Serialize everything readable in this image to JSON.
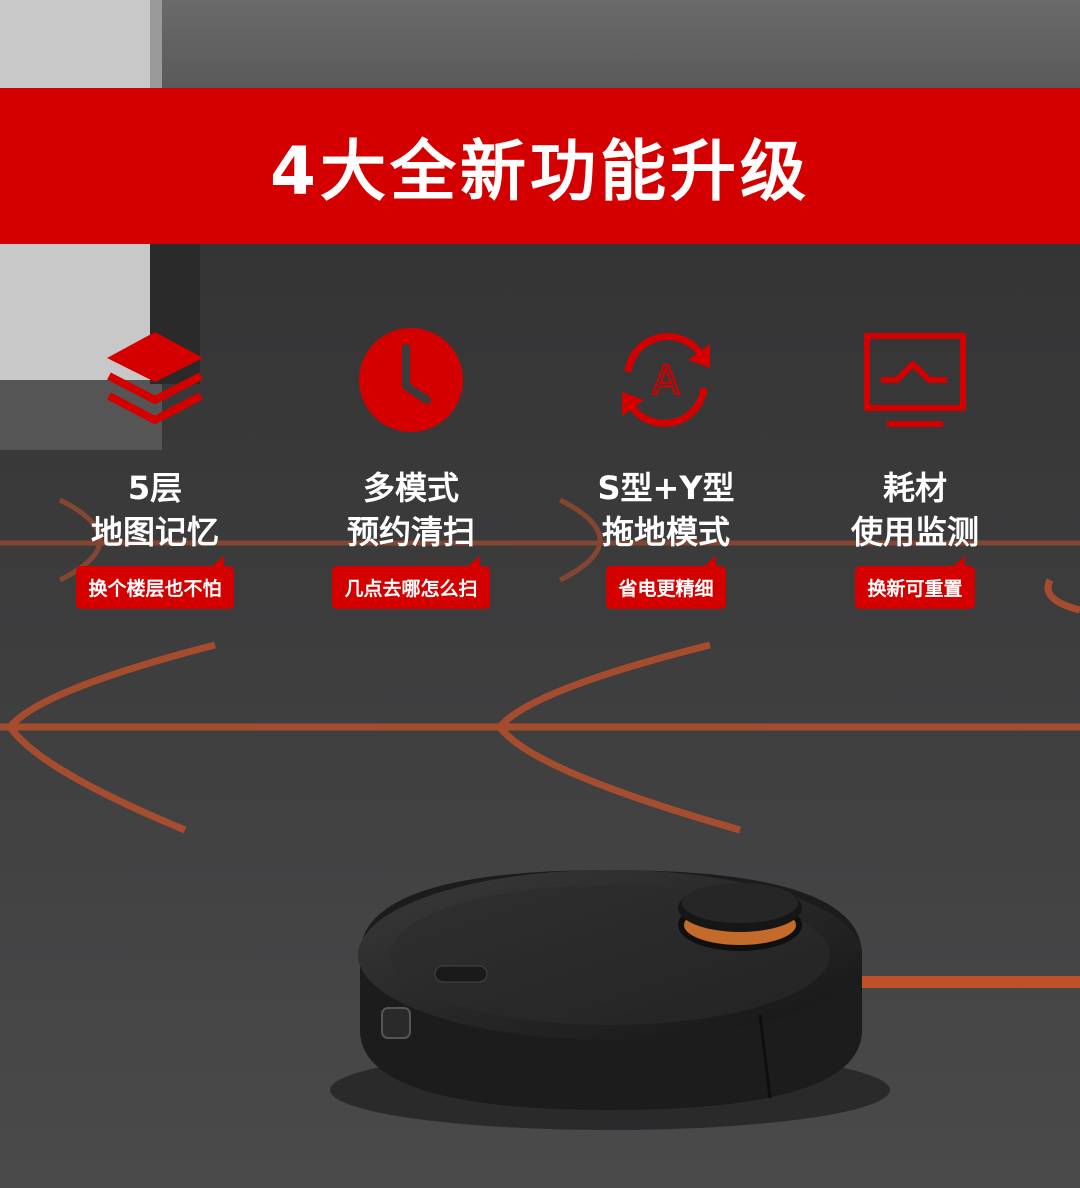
{
  "banner": {
    "title": "4大全新功能升级"
  },
  "features": [
    {
      "icon": "layers-icon",
      "title_line1": "5层",
      "title_line2": "地图记忆",
      "tag": "换个楼层也不怕"
    },
    {
      "icon": "clock-icon",
      "title_line1": "多模式",
      "title_line2": "预约清扫",
      "tag": "几点去哪怎么扫"
    },
    {
      "icon": "mode-switch-icon",
      "title_line1": "S型+Y型",
      "title_line2": "拖地模式",
      "tag": "省电更精细"
    },
    {
      "icon": "monitor-icon",
      "title_line1": "耗材",
      "title_line2": "使用监测",
      "tag": "换新可重置"
    }
  ],
  "colors": {
    "accent": "#d40000",
    "background": "#3b3b3c",
    "path": "#c0502a"
  }
}
